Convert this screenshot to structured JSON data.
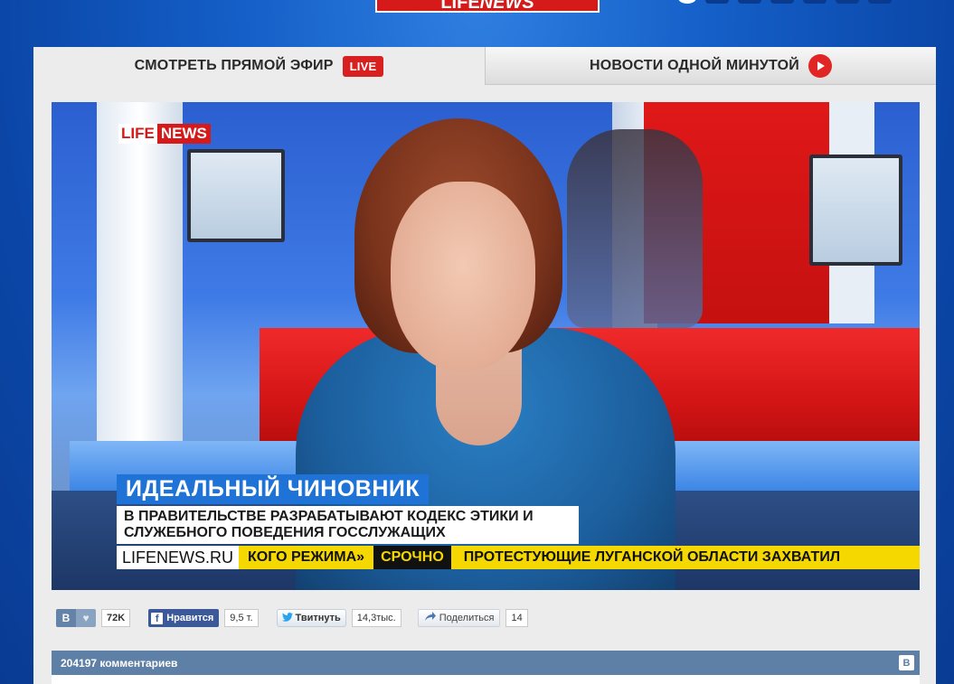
{
  "header": {
    "logo_left": "LIFE",
    "logo_right": "NEWS"
  },
  "tabs": [
    {
      "label": "СМОТРЕТЬ ПРЯМОЙ ЭФИР",
      "badge": "LIVE"
    },
    {
      "label": "НОВОСТИ ОДНОЙ МИНУТОЙ",
      "icon": "play-icon"
    }
  ],
  "video": {
    "channel_logo_left": "LIFE",
    "channel_logo_right": "NEWS",
    "title": "ИДЕАЛЬНЫЙ ЧИНОВНИК",
    "subtitle": "В ПРАВИТЕЛЬСТВЕ РАЗРАБАТЫВАЮТ КОДЕКС ЭТИКИ И СЛУЖЕБНОГО ПОВЕДЕНИЯ ГОССЛУЖАЩИХ",
    "ticker_site": "LIFENEWS.RU",
    "ticker_prev": "КОГО РЕЖИМА»",
    "ticker_urgent": "СРОЧНО",
    "ticker_news": "ПРОТЕСТУЮЩИЕ ЛУГАНСКОЙ ОБЛАСТИ ЗАХВАТИЛ"
  },
  "social": {
    "vk_label": "В",
    "vk_count": "72K",
    "fb_label": "Нравится",
    "fb_count": "9,5 т.",
    "tw_label": "Твитнуть",
    "tw_count": "14,3тыс.",
    "share_label": "Поделиться",
    "share_count": "14"
  },
  "comments": {
    "label": "204197 комментариев",
    "logo": "В"
  },
  "colors": {
    "accent_red": "#d92020",
    "vk_blue": "#5f80a6",
    "fb_blue": "#3b5998",
    "ticker_yellow": "#f4d800"
  }
}
